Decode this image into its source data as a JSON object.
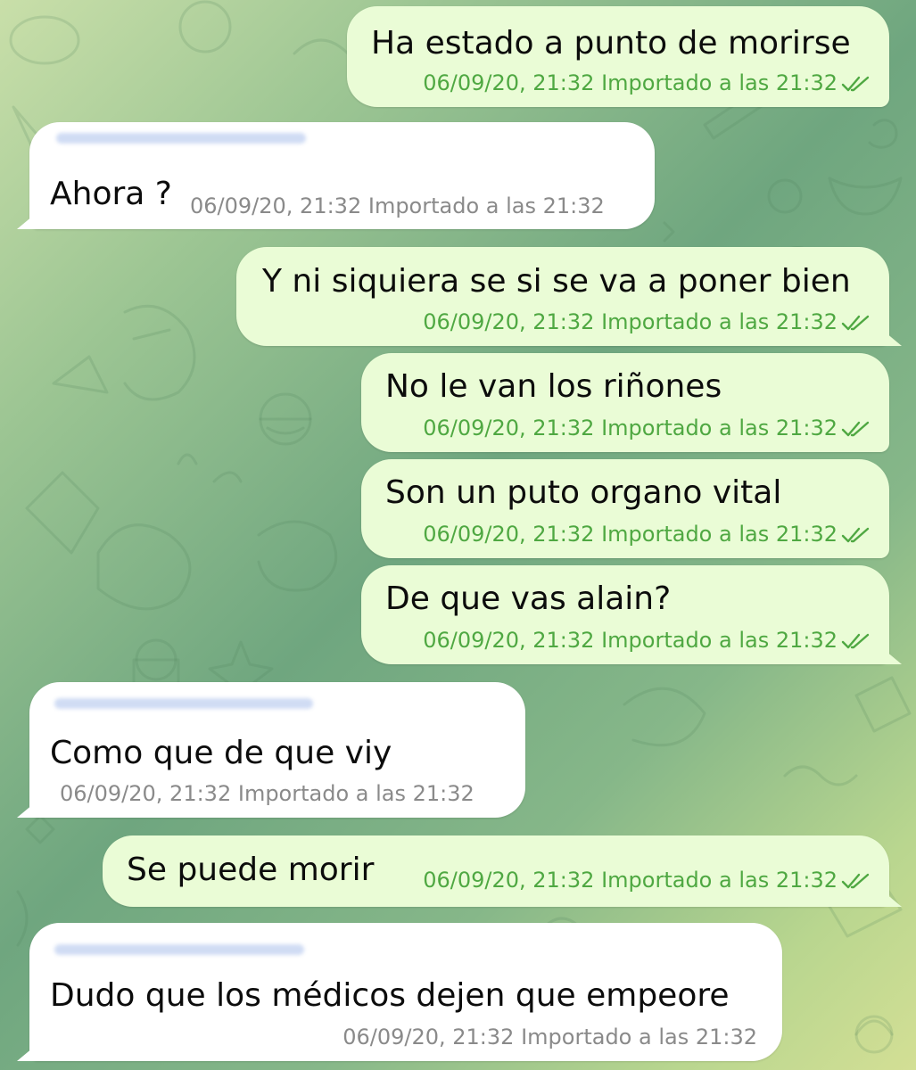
{
  "messages": [
    {
      "id": "m1",
      "direction": "out",
      "text": "Ha estado a punto de morirse",
      "date": "06/09/20, 21:32",
      "import_note": "Importado a las 21:32",
      "status_icon": "double-check-icon"
    },
    {
      "id": "m2",
      "direction": "in",
      "text": "Ahora ?",
      "date": "06/09/20, 21:32",
      "import_note": "Importado a las 21:32"
    },
    {
      "id": "m3",
      "direction": "out",
      "text": "Y ni siquiera se si se va a poner bien",
      "date": "06/09/20, 21:32",
      "import_note": "Importado a las 21:32",
      "status_icon": "double-check-icon"
    },
    {
      "id": "m4",
      "direction": "out",
      "text": "No le van los riñones",
      "date": "06/09/20, 21:32",
      "import_note": "Importado a las 21:32",
      "status_icon": "double-check-icon"
    },
    {
      "id": "m5",
      "direction": "out",
      "text": "Son un puto organo vital",
      "date": "06/09/20, 21:32",
      "import_note": "Importado a las 21:32",
      "status_icon": "double-check-icon"
    },
    {
      "id": "m6",
      "direction": "out",
      "text": "De que vas alain?",
      "date": "06/09/20, 21:32",
      "import_note": "Importado a las 21:32",
      "status_icon": "double-check-icon"
    },
    {
      "id": "m7",
      "direction": "in",
      "text": "Como que de que viy",
      "date": "06/09/20, 21:32",
      "import_note": "Importado a las 21:32"
    },
    {
      "id": "m8",
      "direction": "out",
      "text": "Se puede morir",
      "date": "06/09/20, 21:32",
      "import_note": "Importado a las 21:32",
      "status_icon": "double-check-icon"
    },
    {
      "id": "m9",
      "direction": "in",
      "text": "Dudo que los médicos dejen que empeore",
      "date": "06/09/20, 21:32",
      "import_note": "Importado a las 21:32"
    }
  ],
  "colors": {
    "outgoing_bubble": "#eafcd6",
    "incoming_bubble": "#ffffff",
    "outgoing_meta": "#4fa842",
    "incoming_meta": "#8a8a8a",
    "wallpaper_dark": "#6fa67f",
    "wallpaper_light": "#c9dfa9"
  }
}
